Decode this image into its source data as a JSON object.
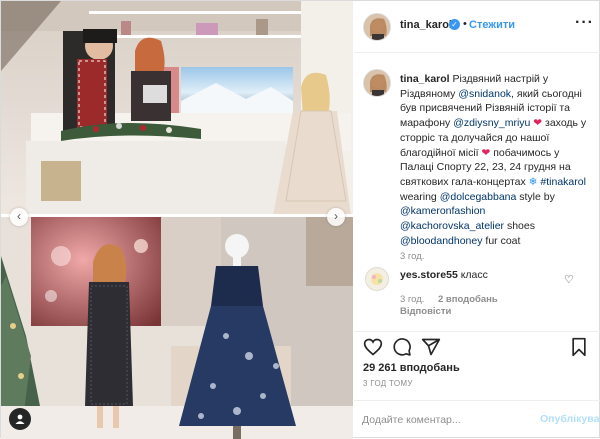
{
  "header": {
    "username": "tina_karol",
    "dot": "•",
    "follow_label": "Стежити",
    "more_icon": "more-horizontal-icon"
  },
  "caption": {
    "username": "tina_karol",
    "t1": " Різдвяний настрій у Різдвяному ",
    "m1": "@snidanok",
    "t2": ", який сьогодні був присвячений Різвяній історії та марафону ",
    "m2": "@zdiysny_mriyu",
    "e1": "❤",
    "t3": " заходь у сторріс та долучайся до нашої благодійної місії ",
    "e2": "❤",
    "t4": " побачимось у Палаці Спорту 22, 23, 24 грудня на святкових гала-концертах ",
    "e3": "❄",
    "t5": " ",
    "h1": "#tinakarol",
    "t6": " wearing ",
    "m3": "@dolcegabbana",
    "t7": " style by ",
    "m4": "@kameronfashion",
    "t8": " ",
    "m5": "@kachorovska_atelier",
    "t9": " shoes ",
    "m6": "@bloodandhoney",
    "t10": " fur coat",
    "time": "3 год."
  },
  "comment2": {
    "username": "yes.store55",
    "text": " класс",
    "time": "3 год.",
    "likes": "2 вподобань",
    "reply": "Відповісти"
  },
  "likes_count": "29 261 вподобань",
  "post_time": "3 ГОД ТОМУ",
  "comment_box": {
    "placeholder": "Додайте коментар...",
    "publish_label": "Опублікувати"
  },
  "colors": {
    "link": "#003569",
    "follow": "#3897f0",
    "verified": "#3897f0",
    "publish_disabled": "#b2dffc",
    "heart": "#e0245e"
  },
  "icons": [
    "heart-icon",
    "comment-icon",
    "share-icon",
    "bookmark-icon",
    "user-tag-icon",
    "chevron-left-icon",
    "chevron-right-icon",
    "verified-badge-icon"
  ]
}
